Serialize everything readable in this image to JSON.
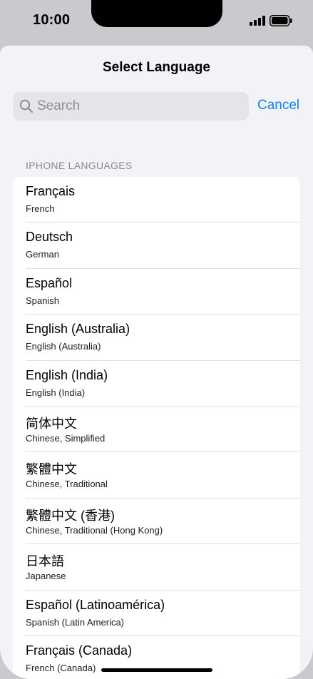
{
  "status_bar": {
    "time": "10:00"
  },
  "header": {
    "title": "Select Language"
  },
  "search": {
    "placeholder": "Search",
    "cancel_label": "Cancel"
  },
  "section": {
    "header": "IPHONE LANGUAGES"
  },
  "languages": [
    {
      "native": "Français",
      "english": "French"
    },
    {
      "native": "Deutsch",
      "english": "German"
    },
    {
      "native": "Español",
      "english": "Spanish"
    },
    {
      "native": "English (Australia)",
      "english": "English (Australia)"
    },
    {
      "native": "English (India)",
      "english": "English (India)"
    },
    {
      "native": "简体中文",
      "english": "Chinese, Simplified"
    },
    {
      "native": "繁體中文",
      "english": "Chinese, Traditional"
    },
    {
      "native": "繁體中文 (香港)",
      "english": "Chinese, Traditional (Hong Kong)"
    },
    {
      "native": "日本語",
      "english": "Japanese"
    },
    {
      "native": "Español (Latinoamérica)",
      "english": "Spanish (Latin America)"
    },
    {
      "native": "Français (Canada)",
      "english": "French (Canada)"
    }
  ]
}
